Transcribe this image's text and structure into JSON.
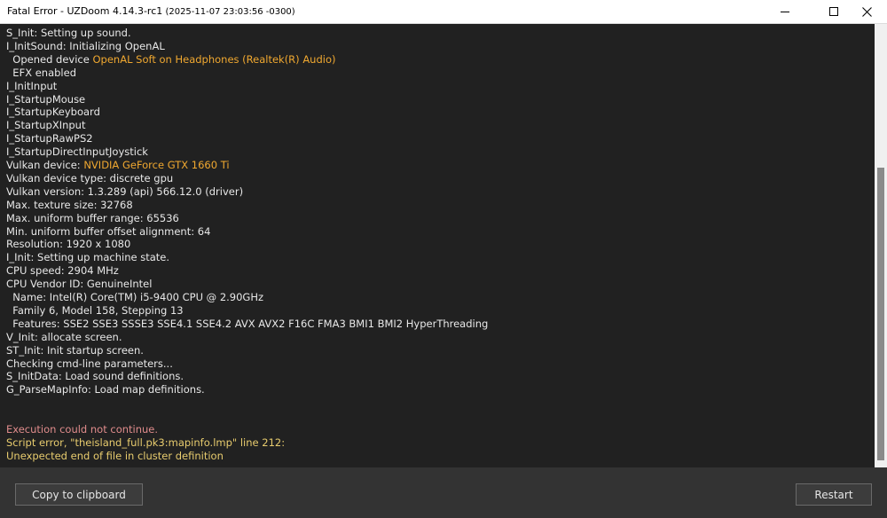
{
  "window": {
    "title": "Fatal Error - UZDoom 4.14.3-rc1",
    "title_suffix": " (2025-11-07 23:03:56 -0300)"
  },
  "log": {
    "lines": [
      {
        "text": "S_Init: Setting up sound.",
        "hl": ""
      },
      {
        "text": "I_InitSound: Initializing OpenAL",
        "hl": ""
      },
      {
        "text": "  Opened device ",
        "hl": "OpenAL Soft on Headphones (Realtek(R) Audio)"
      },
      {
        "text": "  EFX enabled",
        "hl": ""
      },
      {
        "text": "I_InitInput",
        "hl": ""
      },
      {
        "text": "I_StartupMouse",
        "hl": ""
      },
      {
        "text": "I_StartupKeyboard",
        "hl": ""
      },
      {
        "text": "I_StartupXInput",
        "hl": ""
      },
      {
        "text": "I_StartupRawPS2",
        "hl": ""
      },
      {
        "text": "I_StartupDirectInputJoystick",
        "hl": ""
      },
      {
        "text": "Vulkan device: ",
        "hl": "NVIDIA GeForce GTX 1660 Ti"
      },
      {
        "text": "Vulkan device type: discrete gpu",
        "hl": ""
      },
      {
        "text": "Vulkan version: 1.3.289 (api) 566.12.0 (driver)",
        "hl": ""
      },
      {
        "text": "Max. texture size: 32768",
        "hl": ""
      },
      {
        "text": "Max. uniform buffer range: 65536",
        "hl": ""
      },
      {
        "text": "Min. uniform buffer offset alignment: 64",
        "hl": ""
      },
      {
        "text": "Resolution: 1920 x 1080",
        "hl": ""
      },
      {
        "text": "I_Init: Setting up machine state.",
        "hl": ""
      },
      {
        "text": "CPU speed: 2904 MHz",
        "hl": ""
      },
      {
        "text": "CPU Vendor ID: GenuineIntel",
        "hl": ""
      },
      {
        "text": "  Name: Intel(R) Core(TM) i5-9400 CPU @ 2.90GHz",
        "hl": ""
      },
      {
        "text": "  Family 6, Model 158, Stepping 13",
        "hl": ""
      },
      {
        "text": "  Features: SSE2 SSE3 SSSE3 SSE4.1 SSE4.2 AVX AVX2 F16C FMA3 BMI1 BMI2 HyperThreading",
        "hl": ""
      },
      {
        "text": "V_Init: allocate screen.",
        "hl": ""
      },
      {
        "text": "ST_Init: Init startup screen.",
        "hl": ""
      },
      {
        "text": "Checking cmd-line parameters...",
        "hl": ""
      },
      {
        "text": "S_InitData: Load sound definitions.",
        "hl": ""
      },
      {
        "text": "G_ParseMapInfo: Load map definitions.",
        "hl": ""
      }
    ],
    "error_line": "Execution could not continue.",
    "script_error_1": "Script error, \"theisland_full.pk3:mapinfo.lmp\" line 212:",
    "script_error_2": "Unexpected end of file in cluster definition"
  },
  "buttons": {
    "copy_label": "Copy to clipboard",
    "restart_label": "Restart"
  },
  "colors": {
    "highlight": "#f0a830",
    "error": "#e08c8c",
    "warning": "#e8cc6e"
  }
}
